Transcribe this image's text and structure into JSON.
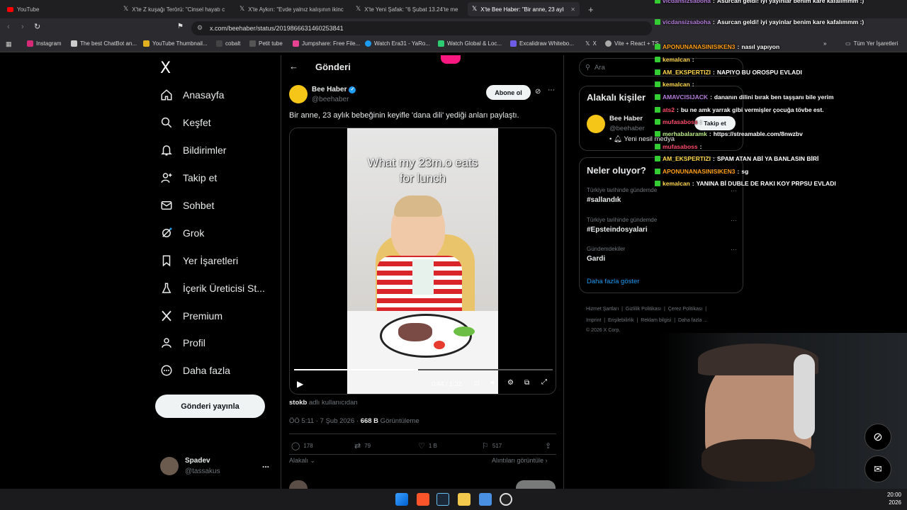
{
  "tabs": [
    {
      "title": "YouTube",
      "active": false
    },
    {
      "title": "X'te Z kuşağı Terörü: \"Cinsel hayatı c",
      "active": false
    },
    {
      "title": "X'te Aykırı: \"Evde yalnız kalışının ikinc",
      "active": false
    },
    {
      "title": "X'te Yeni Şafak: \"6 Şubat 13.24'te me",
      "active": false
    },
    {
      "title": "X'te Bee Haber: \"Bir anne, 23 aylı",
      "active": true
    }
  ],
  "new_tab": "+",
  "url": "x.com/beehaber/status/2019866631460253841",
  "bookmarks": [
    "Instagram",
    "The best ChatBot an...",
    "YouTube Thumbnail...",
    "cobalt",
    "Petit tube",
    "Jumpshare: Free File...",
    "Watch Era31 - YaRo...",
    "Watch Global & Loc...",
    "Excalidraw Whitebo...",
    "X",
    "Vite + React + TS",
    "»",
    "Tüm Yer İşaretleri"
  ],
  "nav": {
    "logo": "X",
    "items": [
      "Anasayfa",
      "Keşfet",
      "Bildirimler",
      "Takip et",
      "Sohbet",
      "Grok",
      "Yer İşaretleri",
      "İçerik Üreticisi St...",
      "Premium",
      "Profil",
      "Daha fazla"
    ],
    "post_button": "Gönderi yayınla",
    "account_name": "Spadev",
    "account_handle": "@tassakus",
    "more": "..."
  },
  "post": {
    "header": "Gönderi",
    "author": "Bee Haber",
    "handle": "@beehaber",
    "subscribe": "Abone ol",
    "text": "Bir anne, 23 aylık bebeğinin keyifle 'dana dili' yediği anları paylaştı.",
    "video_caption": "What my 23m.o eats for lunch",
    "video_time": "0:44 / 1:32",
    "video_progress": 0.48,
    "source_user": "stokb",
    "source_suffix": "adlı kullanıcıdan",
    "timestamp": "ÖÖ 5:11 · 7 Şub 2026 · ",
    "views_count": "668 B",
    "views_label": " Görüntüleme",
    "replies": "178",
    "reposts": "79",
    "likes": "1 B",
    "bookmarks": "517",
    "related": "Alakalı",
    "quotes": "Alıntıları görüntüle"
  },
  "sidebar": {
    "search_placeholder": "Ara",
    "related_title": "Alakalı kişiler",
    "related_name": "Bee Haber",
    "related_handle": "@beehaber",
    "related_bio": "Yeni nesil medya",
    "follow": "Takip et",
    "trends_title": "Neler oluyor?",
    "trends": [
      {
        "context": "Türkiye tarihinde gündemde",
        "name": "#sallandık"
      },
      {
        "context": "Türkiye tarihinde gündemde",
        "name": "#Epsteindosyalari"
      },
      {
        "context": "Gündemdekiler",
        "name": "Gardi"
      }
    ],
    "show_more": "Daha fazla göster",
    "footer_row1": [
      "Hizmet Şartları",
      "Gizlilik Politikası",
      "Çerez Politikası"
    ],
    "footer_row2": [
      "Imprint",
      "Erişilebilirlik",
      "Reklam bilgisi",
      "Daha fazla ..."
    ],
    "copyright": "© 2026 X Corp."
  },
  "chat": [
    {
      "user": "vicdansizsaboha",
      "color": "#b57edc",
      "msg": "Asurcan geldi! iyi yayinlar benim kare kafalımmm :)"
    },
    {
      "user": "vicdansizsaboha",
      "color": "#b57edc",
      "msg": "Asurcan geldi! iyi yayinlar benim kare kafalımmm :)"
    },
    {
      "user": "APONUNANASINISIKEN3",
      "color": "#ff9f1a",
      "msg": "nasıl yapıyon"
    },
    {
      "user": "kemalcan",
      "color": "#ffd84d",
      "msg": ""
    },
    {
      "user": "AM_EKSPERTIZI",
      "color": "#ffd84d",
      "msg": "NAPIYO BU OROSPU EVLADI"
    },
    {
      "user": "kemalcan",
      "color": "#ffd84d",
      "msg": ""
    },
    {
      "user": "AMAVCISIJACK",
      "color": "#b57edc",
      "msg": "dananın dilini bırak ben taşşanı bile yerim"
    },
    {
      "user": "ats2",
      "color": "#ff4d6a",
      "msg": "bu ne amk yarrak gibi vermişler çocuğa tövbe est."
    },
    {
      "user": "mufasaboss",
      "color": "#ff4d6a",
      "msg": ""
    },
    {
      "user": "merhabalaramk",
      "color": "#b8e986",
      "msg": "https://streamable.com/8nwzbv"
    },
    {
      "user": "mufasaboss",
      "color": "#ff4d6a",
      "msg": ""
    },
    {
      "user": "AM_EKSPERTIZI",
      "color": "#ffd84d",
      "msg": "SPAM ATAN ABİ YA BANLASIN BİRİ"
    },
    {
      "user": "APONUNANASINISIKEN3",
      "color": "#ff9f1a",
      "msg": "sg"
    },
    {
      "user": "kemalcan",
      "color": "#ffd84d",
      "msg": "YANINA Bİ DUBLE DE RAKI KOY PRPSU EVLADI"
    }
  ],
  "clock": {
    "time": "20:00",
    "year": "2026"
  },
  "colors": {
    "accent": "#1d9bf0",
    "bg": "#000000",
    "border": "#2f3336"
  }
}
